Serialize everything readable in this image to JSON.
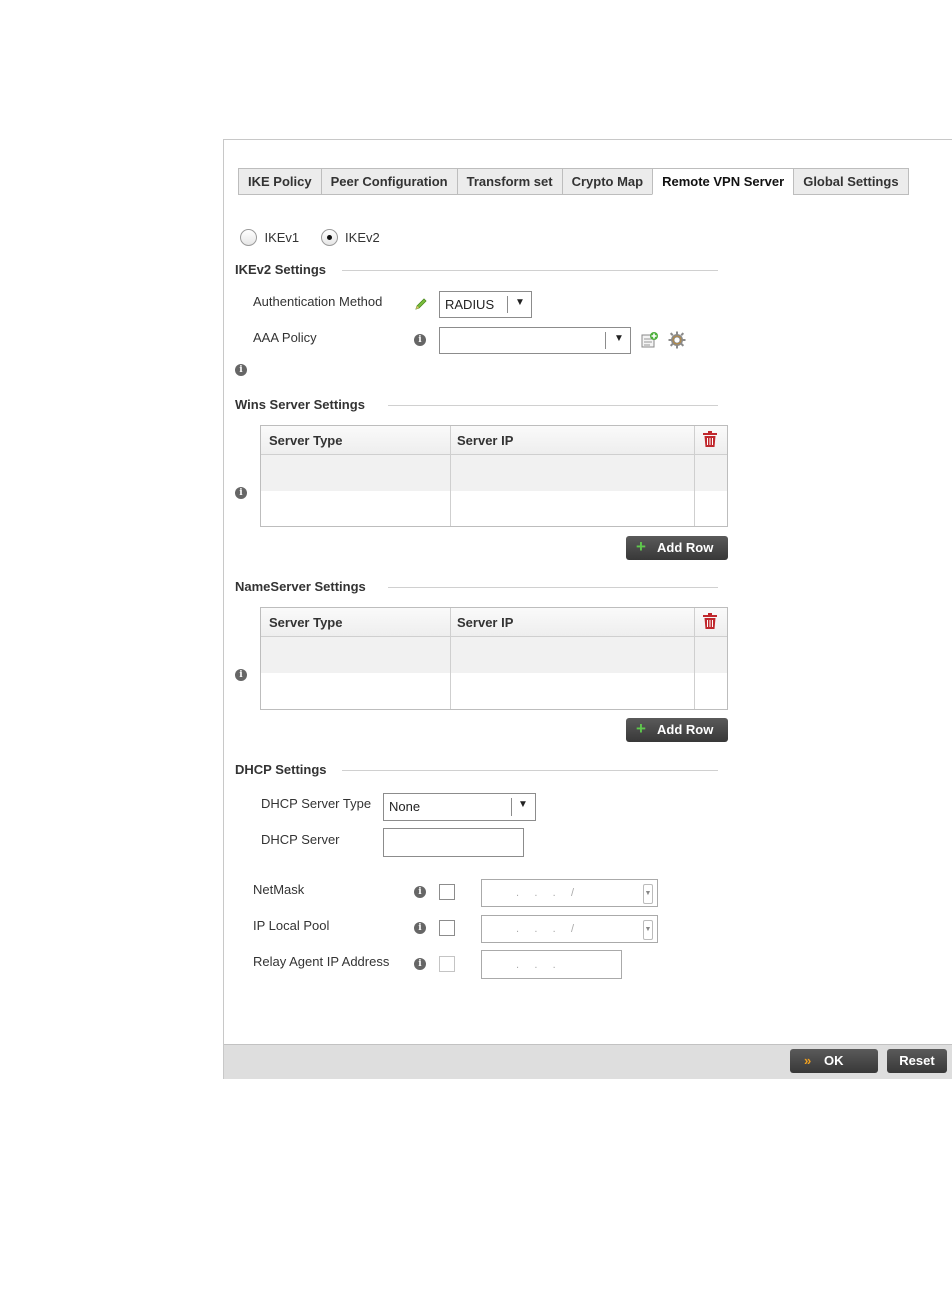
{
  "tabs": [
    {
      "label": "IKE Policy"
    },
    {
      "label": "Peer Configuration"
    },
    {
      "label": "Transform set"
    },
    {
      "label": "Crypto Map"
    },
    {
      "label": "Remote VPN Server",
      "active": true
    },
    {
      "label": "Global Settings"
    }
  ],
  "ike_version": {
    "option1": "IKEv1",
    "option2": "IKEv2",
    "selected": "IKEv2"
  },
  "ikev2_settings": {
    "title": "IKEv2 Settings",
    "auth_method_label": "Authentication Method",
    "auth_method_value": "RADIUS",
    "aaa_policy_label": "AAA Policy",
    "aaa_policy_value": ""
  },
  "wins": {
    "title": "Wins Server Settings",
    "columns": [
      "Server Type",
      "Server IP"
    ],
    "rows": [],
    "add_row_label": "Add Row"
  },
  "nameserver": {
    "title": "NameServer Settings",
    "columns": [
      "Server Type",
      "Server IP"
    ],
    "rows": [],
    "add_row_label": "Add Row"
  },
  "dhcp": {
    "title": "DHCP Settings",
    "server_type_label": "DHCP Server Type",
    "server_type_value": "None",
    "server_label": "DHCP Server",
    "server_value": "",
    "netmask_label": "NetMask",
    "netmask_placeholder": ".     .     .     /",
    "ip_local_pool_label": "IP Local Pool",
    "ip_local_pool_placeholder": ".     .     .     /",
    "relay_agent_label": "Relay Agent IP Address",
    "relay_agent_placeholder": ".     .     ."
  },
  "footer": {
    "ok_label": "OK",
    "reset_label": "Reset"
  },
  "colors": {
    "accent_green": "#5fc84d",
    "trash_red": "#c0282d",
    "ok_chevron": "#f0a020",
    "button_dark": "#444444"
  }
}
